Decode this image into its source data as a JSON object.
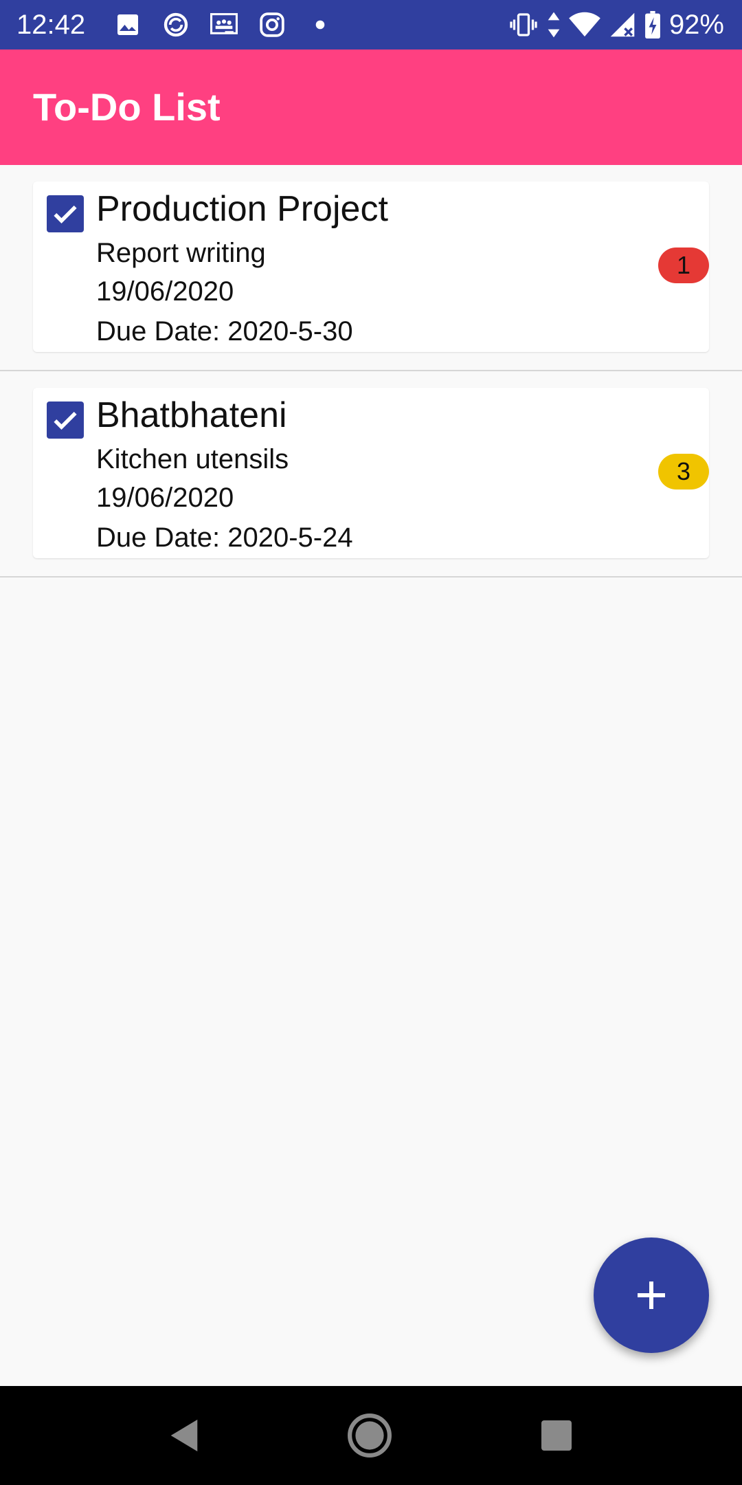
{
  "status_bar": {
    "time": "12:42",
    "battery": "92%",
    "left_icons": [
      "gallery-icon",
      "sync-icon",
      "classroom-icon",
      "instagram-icon",
      "dot-icon"
    ],
    "right_icons": [
      "vibrate-icon",
      "data-arrows-icon",
      "wifi-icon",
      "signal-icon",
      "battery-charging-icon"
    ]
  },
  "app_bar": {
    "title": "To-Do List"
  },
  "tasks": [
    {
      "title": "Production Project",
      "description": "Report writing",
      "date": "19/06/2020",
      "due": "Due Date: 2020-5-30",
      "priority": "1",
      "priority_color": "#e53935",
      "checked": true
    },
    {
      "title": "Bhatbhateni",
      "description": "Kitchen utensils",
      "date": "19/06/2020",
      "due": "Due Date: 2020-5-24",
      "priority": "3",
      "priority_color": "#f0c400",
      "checked": true
    }
  ],
  "fab": {
    "icon": "plus-icon"
  },
  "nav_bar": {
    "icons": [
      "back-icon",
      "home-icon",
      "recents-icon"
    ]
  },
  "colors": {
    "primary": "#303f9f",
    "accent": "#ff4081",
    "background": "#f9f9f9"
  }
}
